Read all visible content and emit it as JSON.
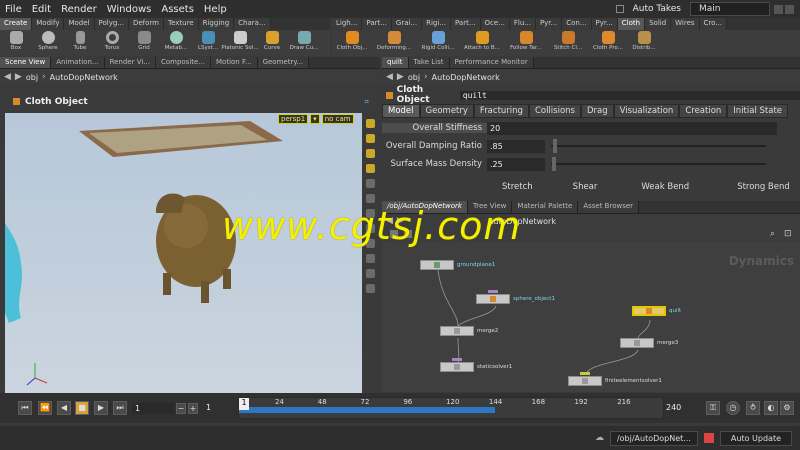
{
  "menu": {
    "items": [
      "File",
      "Edit",
      "Render",
      "Windows",
      "Assets",
      "Help"
    ],
    "auto_takes": "Auto Takes",
    "desktop": "Main"
  },
  "shelf_left": {
    "tabs": [
      "Create",
      "Modify",
      "Model",
      "Polyg...",
      "Deform",
      "Texture",
      "Rigging",
      "Chara..."
    ],
    "tools": [
      "Box",
      "Sphere",
      "Tube",
      "Torus",
      "Grid",
      "Metab...",
      "LSyst...",
      "Platonic Sol...",
      "Curve",
      "Draw Cu..."
    ]
  },
  "shelf_right": {
    "tabs": [
      "Ligh...",
      "Part...",
      "Grai...",
      "Rigi...",
      "Part...",
      "Oce...",
      "Flu...",
      "Pyr...",
      "Con...",
      "Pyr...",
      "Cloth",
      "Solid",
      "Wires",
      "Cro..."
    ],
    "active_tab": "Cloth",
    "tools": [
      "Cloth Obj...",
      "Deforming...",
      "Rigid Colli...",
      "Attach to B...",
      "Follow Tar...",
      "Stitch Cl...",
      "Cloth Pro...",
      "Distrib..."
    ]
  },
  "left_pane": {
    "tabs": [
      "Scene View",
      "Animation...",
      "Render Vi...",
      "Composite...",
      "Motion F...",
      "Geometry..."
    ],
    "path": "obj",
    "network": "AutoDopNetwork",
    "viewport_title": "Cloth Object",
    "camera": "persp1",
    "cam2": "no cam"
  },
  "param_pane": {
    "tabs": [
      "quilt",
      "Take List",
      "Performance Monitor"
    ],
    "path": "obj",
    "network": "AutoDopNetwork",
    "title": "Cloth Object",
    "node_name": "quilt",
    "param_tabs": [
      "Model",
      "Geometry",
      "Fracturing",
      "Collisions",
      "Drag",
      "Visualization",
      "Creation",
      "Initial State"
    ],
    "params": [
      {
        "label": "Overall Stiffness",
        "value": "20"
      },
      {
        "label": "Overall Damping Ratio",
        "value": ".85"
      },
      {
        "label": "Surface Mass Density",
        "value": ".25"
      }
    ],
    "headers": [
      "Stretch",
      "Shear",
      "Weak Bend",
      "Strong Bend"
    ]
  },
  "network_pane": {
    "tabs": [
      "/obj/AutoDopNetwork",
      "Tree View",
      "Material Palette",
      "Asset Browser"
    ],
    "network": "AutoDopNetwork",
    "context_label": "Dynamics",
    "nodes": [
      {
        "name": "groundplane1"
      },
      {
        "name": "sphere_object1"
      },
      {
        "name": "merge2"
      },
      {
        "name": "quilt"
      },
      {
        "name": "merge3"
      },
      {
        "name": "staticsolver1"
      },
      {
        "name": "finiteelementsolver1"
      }
    ]
  },
  "timeline": {
    "current_frame": "1",
    "step": "1",
    "start_field": "1",
    "end": "240",
    "ticks": [
      "24",
      "48",
      "72",
      "96",
      "120",
      "144",
      "168",
      "192",
      "216"
    ],
    "cached_fraction": 0.6
  },
  "status": {
    "path": "/obj/AutoDopNet...",
    "update_mode": "Auto Update"
  },
  "watermark": "www.cgtsj.com"
}
